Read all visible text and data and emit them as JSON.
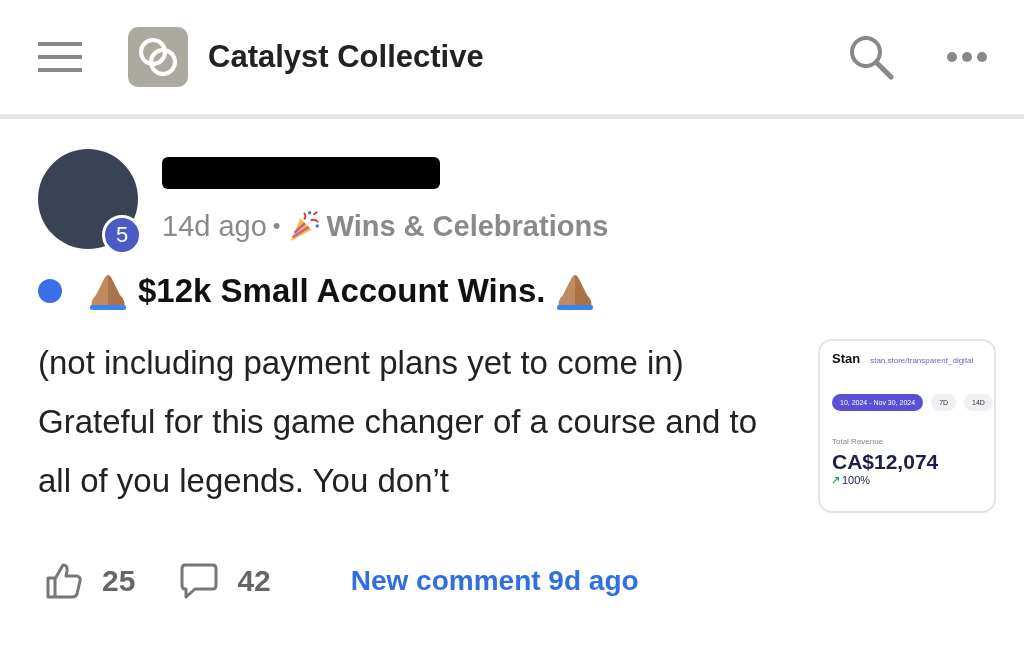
{
  "header": {
    "title": "Catalyst Collective"
  },
  "post": {
    "author_level": "5",
    "time": "14d ago",
    "separator": "•",
    "category": "Wins & Celebrations",
    "unread": true,
    "title": "$12k Small Account Wins.",
    "body": "(not including payment plans yet to come in) Grateful for this game changer of a course and to all of you legends. You don’t",
    "thumbnail": {
      "brand": "Stan",
      "url": "stan.store/transparent_digital",
      "date_range": "10, 2024 - Nov 30, 2024",
      "ranges": [
        {
          "label": "7D",
          "selected": false
        },
        {
          "label": "14D",
          "selected": false
        }
      ],
      "metric_label": "Total Revenue",
      "metric_value": "CA$12,074",
      "change": "100%"
    },
    "likes": "25",
    "comments": "42",
    "new_comment": "New comment 9d ago"
  }
}
